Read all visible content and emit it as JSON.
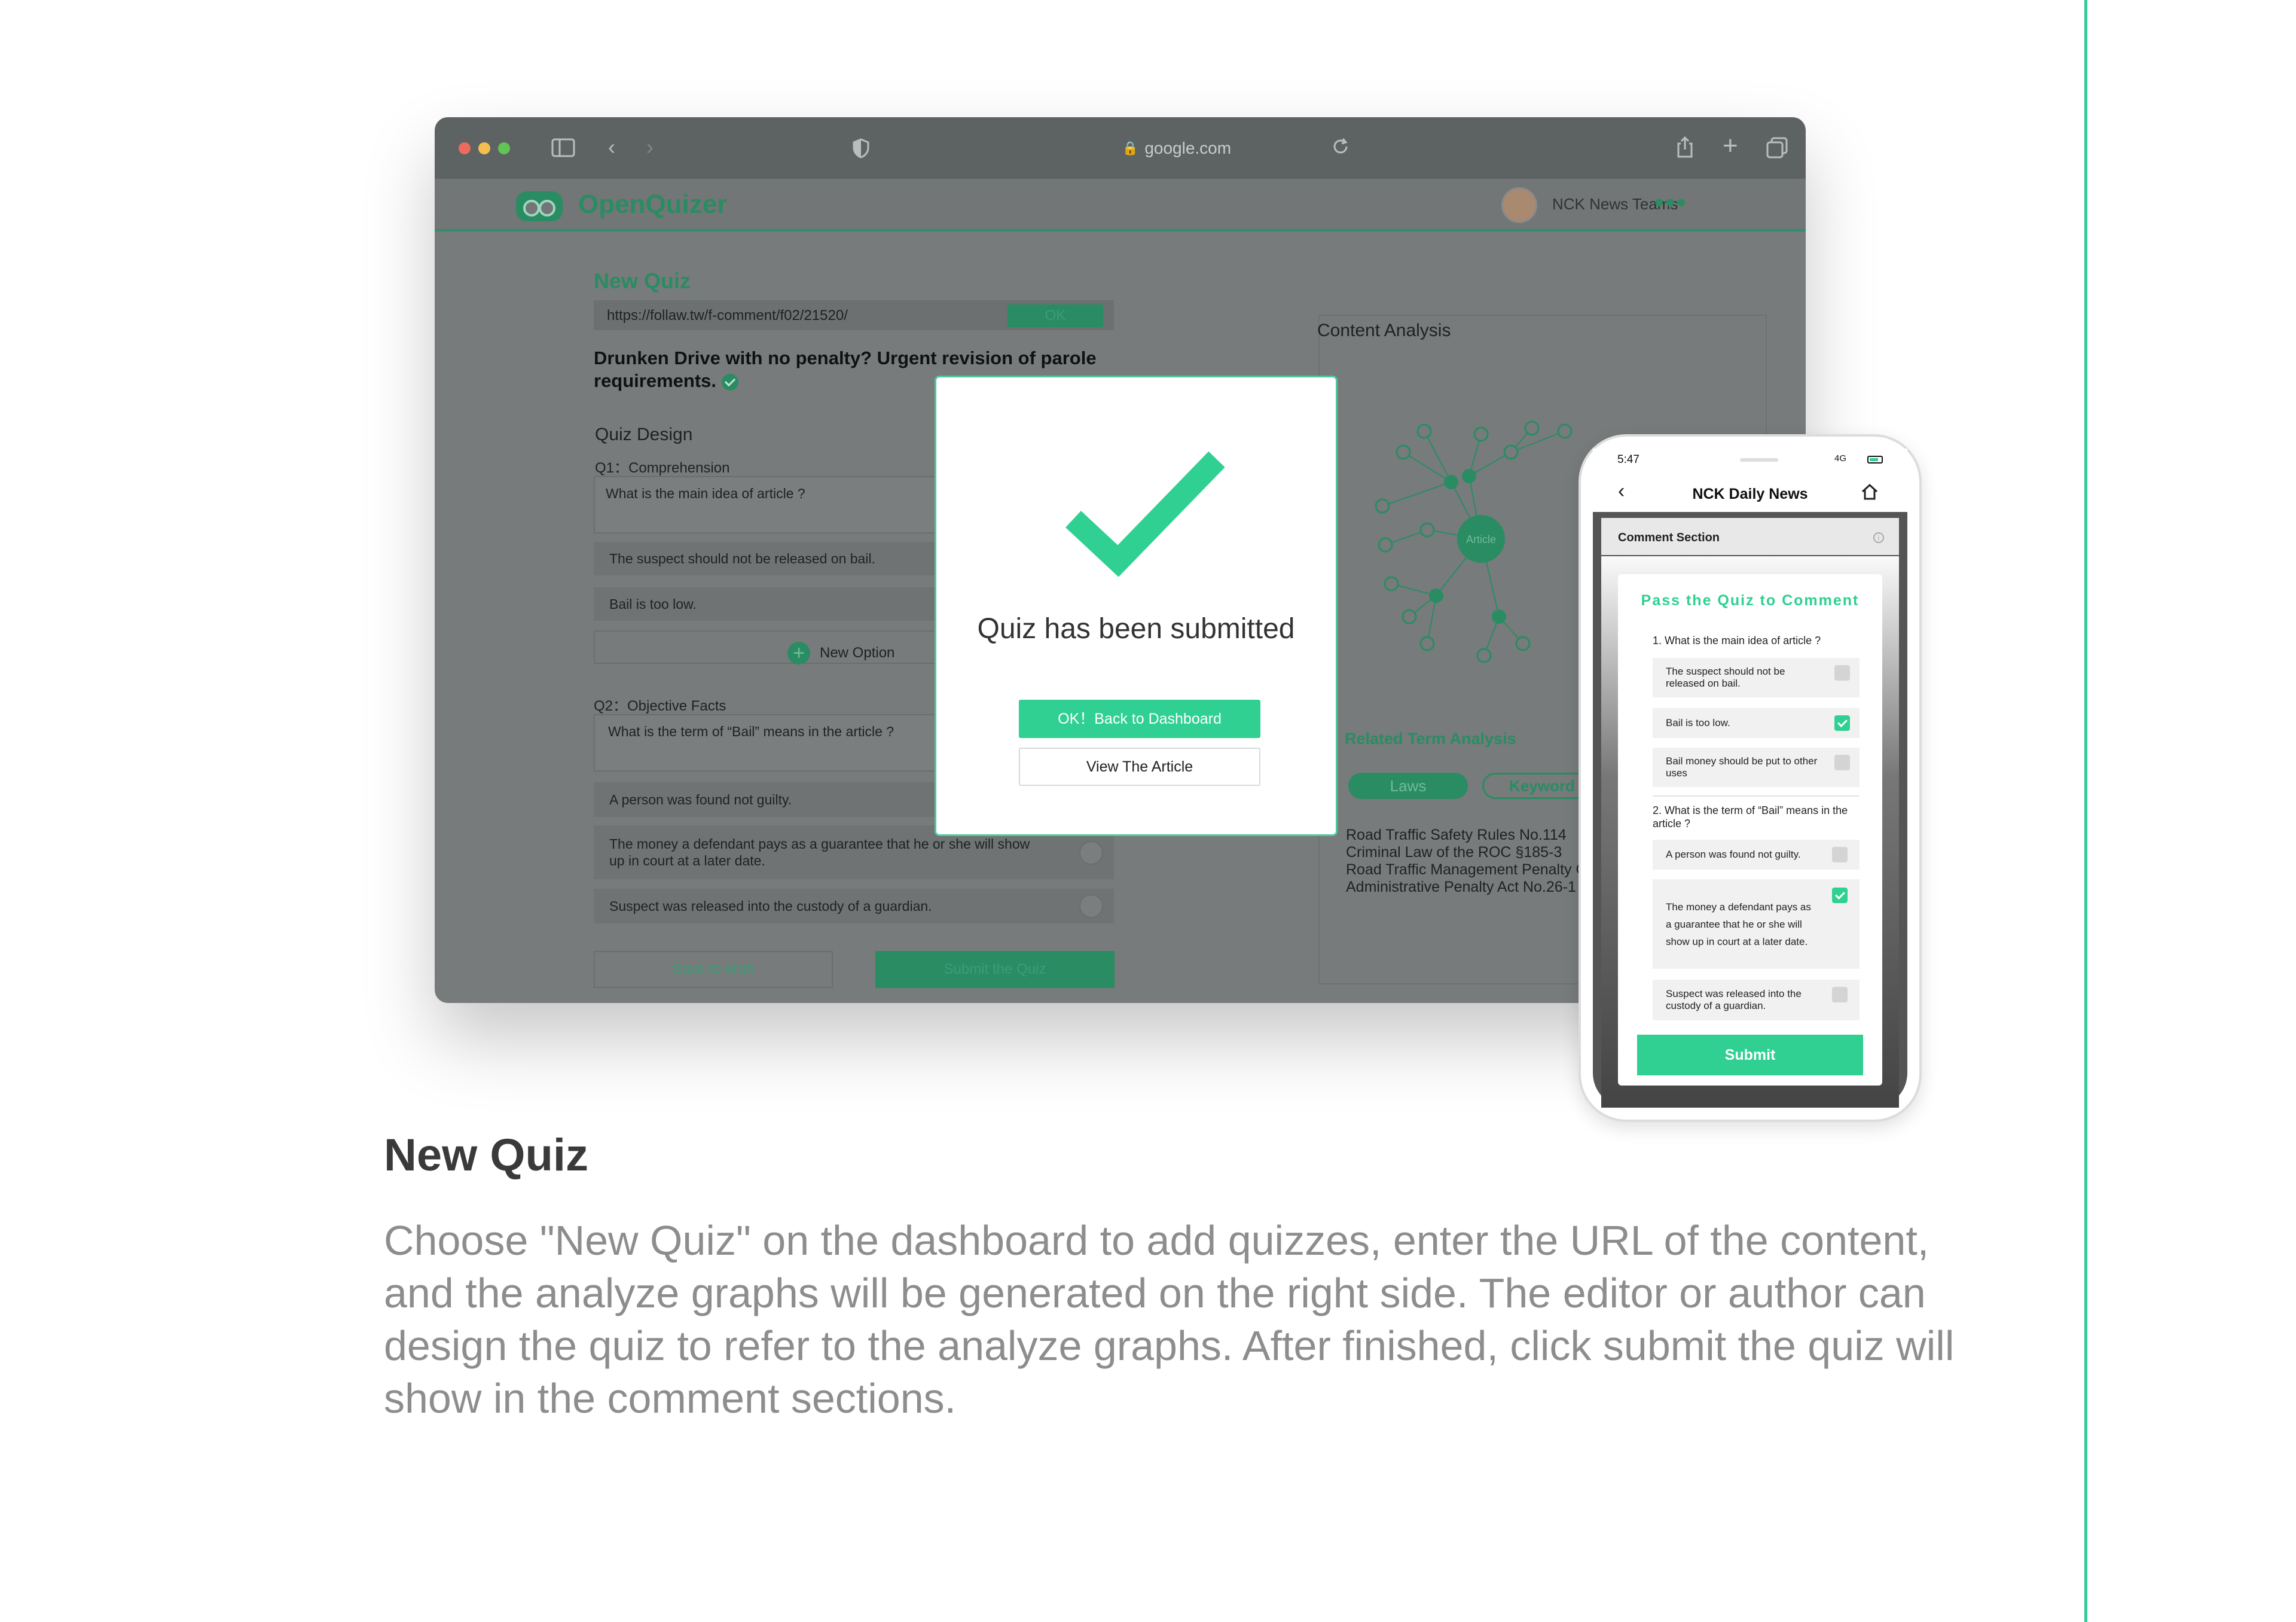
{
  "browser": {
    "address": "google.com"
  },
  "app": {
    "brand": "OpenQuizer",
    "team_name": "NCK News Teams",
    "more": "•••"
  },
  "form": {
    "title": "New Quiz",
    "url_value": "https://follaw.tw/f-comment/f02/21520/",
    "ok_label": "OK",
    "headline": "Drunken Drive with no penalty? Urgent revision of parole requirements.",
    "quiz_design_label": "Quiz Design",
    "q1_label": "Q1：Comprehension",
    "q1_text": "What is the main idea of article ?",
    "q1_options": [
      "The suspect should not be released on bail.",
      "Bail is too low."
    ],
    "new_option": "New Option",
    "q2_label": "Q2：Objective Facts",
    "q2_text": "What is the term of  “Bail” means in the article ?",
    "q2_options": [
      "A person was found not guilty.",
      "The money a defendant pays as a guarantee that he or she will show up in court at a later date.",
      "Suspect was released into the custody of a guardian."
    ],
    "save_label": "Save to draft",
    "submit_label": "Submit the Quiz"
  },
  "analysis": {
    "title": "Content Analysis",
    "center_node": "Article",
    "related_title": "Related Term Analysis",
    "tab_laws": "Laws",
    "tab_keyword": "Keyword",
    "laws": [
      "Road Traffic Safety Rules  No.114",
      "Criminal Law of the ROC §185-3",
      "Road Traffic Management Penalty Or",
      "Administrative Penalty Act No.26-1"
    ]
  },
  "modal": {
    "title": "Quiz has been submitted",
    "ok_label": "OK！Back to Dashboard",
    "view_label": "View The Article"
  },
  "phone": {
    "time": "5:47",
    "network": "4G",
    "title": "NCK Daily News",
    "section": "Comment Section",
    "card_title": "Pass the Quiz to Comment",
    "q1": "1. What is the main idea of article ?",
    "q1_options": [
      "The suspect should not be released on bail.",
      "Bail is too low.",
      "Bail money should be put to other uses"
    ],
    "q1_checked": [
      false,
      true,
      false
    ],
    "q2": "2. What is the term of  “Bail” means in the article ?",
    "q2_options": [
      "A person was found not guilty.",
      "The money a defendant pays as a guarantee that he or she will show up in court at a later date.",
      "Suspect was released into the custody of a guardian."
    ],
    "q2_checked": [
      false,
      true,
      false
    ],
    "submit": "Submit"
  },
  "caption": {
    "title": "New Quiz",
    "body": "Choose \"New Quiz\" on the dashboard to add quizzes, enter the URL of the content, and the analyze graphs will be generated on the right side. The editor or author can design the quiz to refer to the analyze graphs. After finished, click submit the quiz will show in the comment sections."
  },
  "colors": {
    "accent": "#2fd091",
    "accent_dim": "#2a8c63",
    "divider": "#33cc99"
  }
}
